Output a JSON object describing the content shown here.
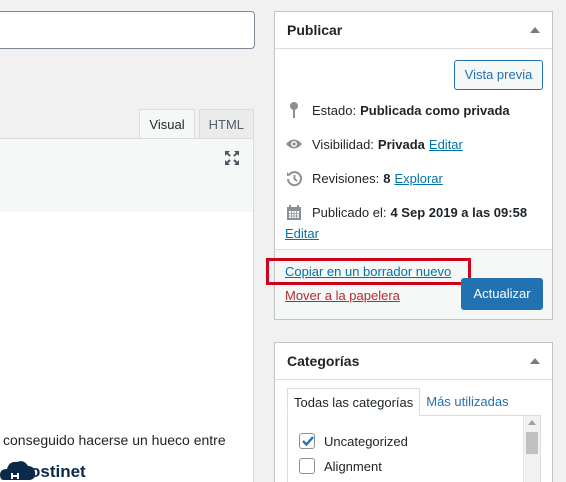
{
  "editor": {
    "tabs": [
      "Visual",
      "HTML"
    ],
    "visible_text": "conseguido hacerse un hueco entre"
  },
  "brand": {
    "logo_text": "Hostinet"
  },
  "publish": {
    "title": "Publicar",
    "preview_label": "Vista previa",
    "status_label": "Estado:",
    "status_value": "Publicada como privada",
    "visibility_label": "Visibilidad:",
    "visibility_value": "Privada",
    "visibility_edit": "Editar",
    "revisions_label": "Revisiones:",
    "revisions_value": "8",
    "revisions_link": "Explorar",
    "published_label": "Publicado el:",
    "published_value": "4 Sep 2019 a las 09:58",
    "date_edit": "Editar",
    "copy_link": "Copiar en un borrador nuevo",
    "trash_link": "Mover a la papelera",
    "update_label": "Actualizar"
  },
  "categories": {
    "title": "Categorías",
    "tabs": [
      "Todas las categorías",
      "Más utilizadas"
    ],
    "items": [
      {
        "label": "Uncategorized",
        "checked": true
      },
      {
        "label": "Alignment",
        "checked": false
      }
    ]
  },
  "colors": {
    "accent": "#2271b1",
    "highlight": "#d0021b",
    "trash": "#b32d2e"
  }
}
